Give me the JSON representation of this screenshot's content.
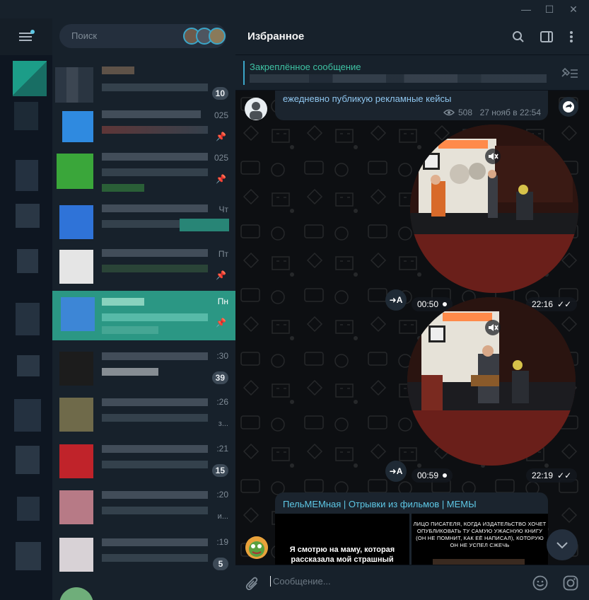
{
  "window": {
    "minimize": "—",
    "maximize": "☐",
    "close": "✕"
  },
  "search": {
    "placeholder": "Поиск"
  },
  "chats": [
    {
      "day": "",
      "badge": "10",
      "pinned": false,
      "sub": ""
    },
    {
      "day": "025",
      "badge": "",
      "pinned": true,
      "sub": ""
    },
    {
      "day": "025",
      "badge": "",
      "pinned": true,
      "sub": ""
    },
    {
      "day": "Чт",
      "badge": "",
      "pinned": false,
      "sub": ""
    },
    {
      "day": "Пт",
      "badge": "",
      "pinned": true,
      "sub": ""
    },
    {
      "day": "Пн",
      "badge": "",
      "pinned": true,
      "sub": "",
      "active": true
    },
    {
      "day": ":30",
      "badge": "39",
      "pinned": false,
      "sub": ""
    },
    {
      "day": ":26",
      "badge": "",
      "pinned": false,
      "sub": "з..."
    },
    {
      "day": ":21",
      "badge": "15",
      "pinned": false,
      "sub": ""
    },
    {
      "day": ":20",
      "badge": "",
      "pinned": false,
      "sub": "и..."
    },
    {
      "day": ":19",
      "badge": "5",
      "pinned": false,
      "sub": ""
    }
  ],
  "chat": {
    "title": "Избранное",
    "pinned_title": "Закреплённое сообщение",
    "message1": {
      "text": "ежедневно публикую рекламные кейсы",
      "views": "508",
      "time": "27 нояб в 22:54"
    },
    "video1": {
      "duration": "00:50",
      "time": "22:16",
      "translate": "A"
    },
    "video2": {
      "duration": "00:59",
      "time": "22:19",
      "translate": "A"
    },
    "message2": {
      "channel": "ПельМЕМная | Отрывки из фильмов | МЕМЫ",
      "caption_left": "Я смотрю на маму, которая рассказала мой страшный",
      "caption_right": "ЛИЦО ПИСАТЕЛЯ, КОГДА ИЗДАТЕЛЬСТВО ХОЧЕТ ОПУБЛИКОВАТЬ ТУ САМУЮ УЖАСНУЮ КНИГУ (ОН НЕ ПОМНИТ, КАК ЕЁ НАПИСАЛ), КОТОРУЮ ОН НЕ УСПЕЛ СЖЕЧЬ"
    },
    "composer_placeholder": "Сообщение..."
  },
  "colors": {
    "accent": "#2b9784",
    "link": "#5ec8e6",
    "pinned": "#3fc3a4"
  }
}
